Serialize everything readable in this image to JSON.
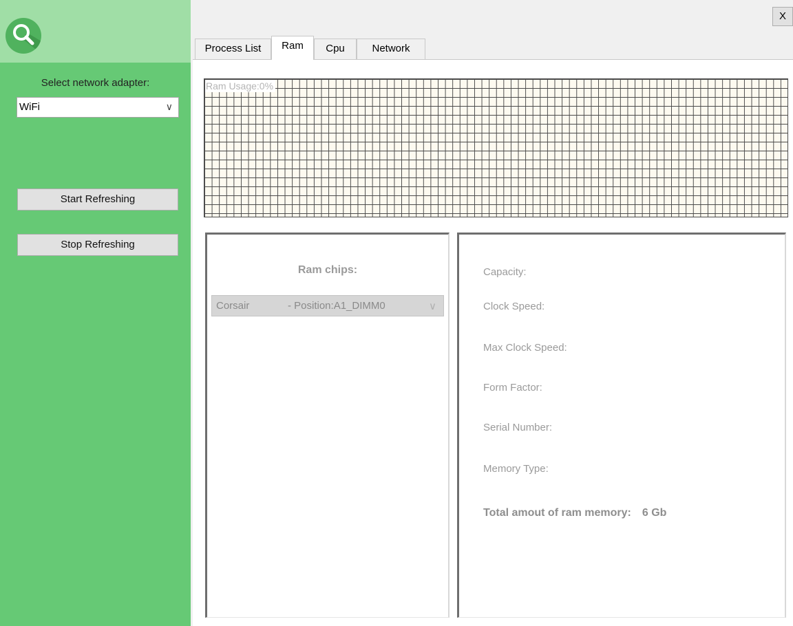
{
  "sidebar": {
    "logo_icon": "magnifier-icon",
    "adapter_label": "Select network adapter:",
    "adapter_value": "WiFi",
    "start_button": "Start Refreshing",
    "stop_button": "Stop Refreshing",
    "colors": {
      "sidebar": "#66c975",
      "header": "#a0dea6"
    }
  },
  "window": {
    "close_label": "X"
  },
  "tabs": [
    {
      "label": "Process List"
    },
    {
      "label": "Ram",
      "active": true
    },
    {
      "label": "Cpu"
    },
    {
      "label": "Network"
    }
  ],
  "ram": {
    "usage_label": "Ram Usage:0%",
    "usage_percent": 0,
    "chips_title": "Ram chips:",
    "chip_select": {
      "manufacturer": "Corsair",
      "position": "- Position:A1_DIMM0"
    },
    "properties": {
      "capacity": "Capacity:",
      "clock_speed": "Clock Speed:",
      "max_clock_speed": "Max Clock Speed:",
      "form_factor": "Form Factor:",
      "serial_number": "Serial Number:",
      "memory_type": "Memory Type:"
    },
    "total_label": "Total amout of ram memory:",
    "total_value": "6 Gb"
  }
}
